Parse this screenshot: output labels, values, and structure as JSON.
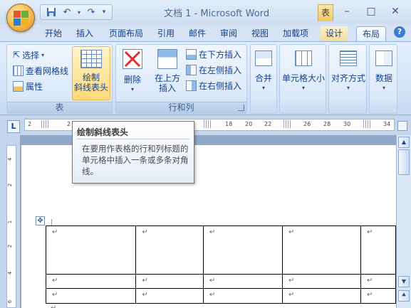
{
  "window": {
    "title": "文档 1 - Microsoft Word",
    "context_tab": "表",
    "controls": {
      "minimize": "–",
      "maximize": "□",
      "close": "✕"
    }
  },
  "quick_access": {
    "save_icon": "save-icon",
    "undo_icon": "undo-icon",
    "redo_icon": "redo-icon",
    "customize_icon": "customize-qat-icon"
  },
  "tabs": [
    {
      "label": "开始"
    },
    {
      "label": "插入"
    },
    {
      "label": "页面布局"
    },
    {
      "label": "引用"
    },
    {
      "label": "邮件"
    },
    {
      "label": "审阅"
    },
    {
      "label": "视图"
    },
    {
      "label": "加载项"
    },
    {
      "label": "设计"
    },
    {
      "label": "布局",
      "active": true
    }
  ],
  "ribbon": {
    "table_group": {
      "label": "表",
      "select": "选择",
      "view_gridlines": "查看网格线",
      "properties": "属性",
      "draw_diagonal_line1": "绘制",
      "draw_diagonal_line2": "斜线表头"
    },
    "rows_cols_group": {
      "label": "行和列",
      "delete": "删除",
      "insert_above_line1": "在上方",
      "insert_above_line2": "插入",
      "insert_below": "在下方插入",
      "insert_left": "在左侧插入",
      "insert_right": "在右侧插入"
    },
    "merge": "合并",
    "cell_size": "单元格大小",
    "alignment": "对齐方式",
    "data": "数据"
  },
  "ruler": {
    "tab_selector": "L",
    "h_numbers": [
      "2",
      "2",
      "18",
      "20",
      "22",
      "26",
      "28",
      "30",
      "34"
    ],
    "v_numbers": [
      "4",
      "2",
      "1",
      "2",
      "4",
      "6"
    ]
  },
  "tooltip": {
    "title": "绘制斜线表头",
    "body": "在要用作表格的行和列标题的单元格中插入一条或多条对角线。"
  },
  "document": {
    "cell_mark": "↵",
    "paragraph_mark": "↵",
    "table_rows": [
      [
        "↵",
        "↵",
        "↵",
        "↵",
        "↵"
      ],
      [
        "↵",
        "↵",
        "↵",
        "↵",
        "↵"
      ],
      [
        "↵",
        "↵",
        "↵",
        "↵",
        "↵"
      ]
    ]
  },
  "colors": {
    "ribbon_text": "#15428b",
    "active_highlight": "#ffd97a",
    "ribbon_bg": "#dce9f9"
  }
}
